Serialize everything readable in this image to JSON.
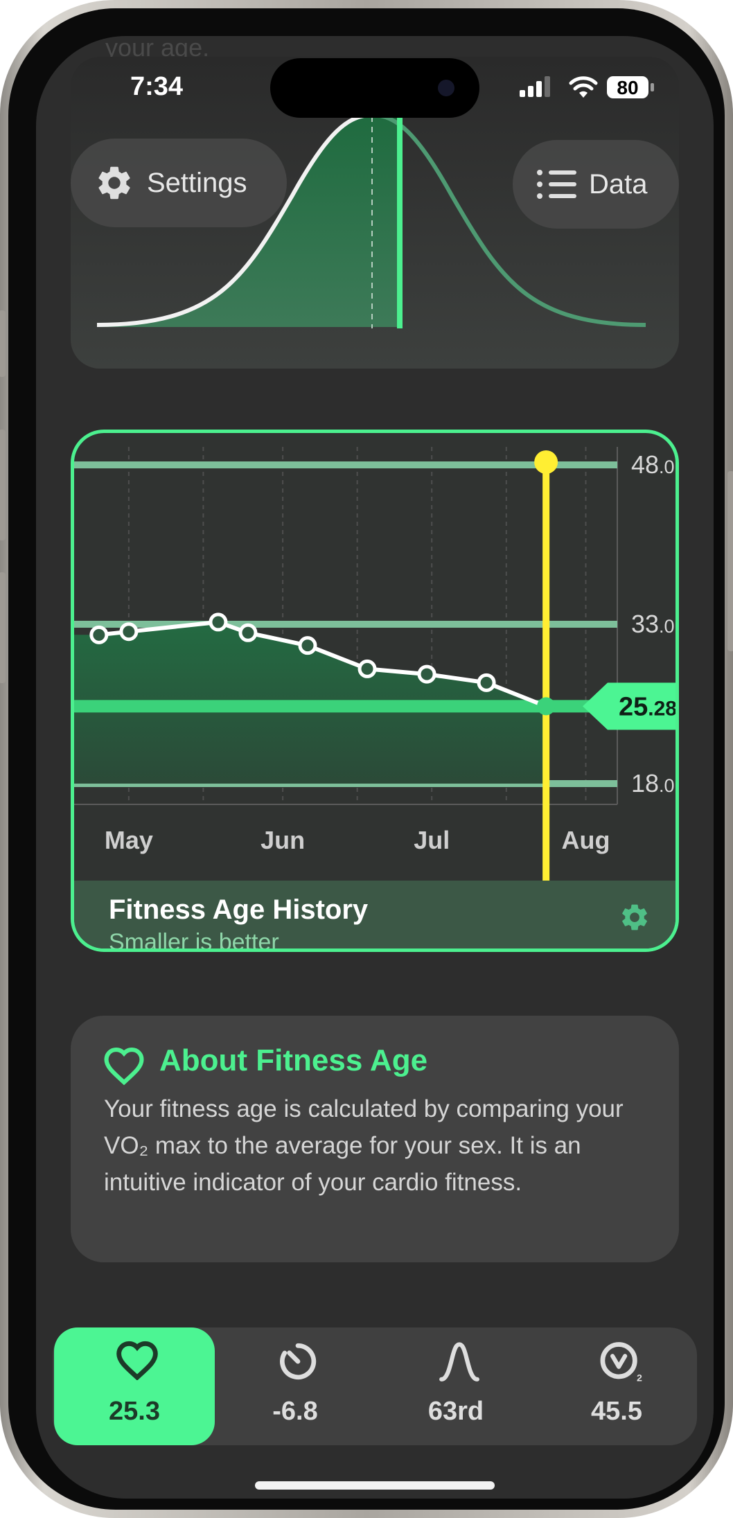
{
  "status": {
    "time": "7:34",
    "battery": "80"
  },
  "header": {
    "faded_text": "your age.",
    "settings_label": "Settings",
    "data_label": "Data"
  },
  "chart": {
    "title": "Fitness Age History",
    "subtitle": "Smaller is better",
    "current_whole": "25",
    "current_frac": ".28",
    "y_ticks": [
      {
        "main": "48",
        "frac": ".0"
      },
      {
        "main": "33",
        "frac": ".0"
      },
      {
        "main": "18",
        "frac": ".0"
      }
    ],
    "months": [
      "May",
      "Jun",
      "Jul",
      "Aug"
    ]
  },
  "chart_data": {
    "type": "area",
    "title": "Fitness Age History",
    "subtitle": "Smaller is better",
    "y_ticks": [
      48.0,
      33.0,
      18.0
    ],
    "ylim": [
      18.0,
      48.0
    ],
    "x_tick_labels": [
      "May",
      "Jun",
      "Jul",
      "Aug"
    ],
    "x": [
      "Apr 25",
      "May 1",
      "May 19",
      "May 25",
      "Jun 6",
      "Jun 18",
      "Jun 30",
      "Jul 12"
    ],
    "values": [
      32.0,
      32.3,
      33.2,
      32.2,
      31.0,
      28.8,
      28.3,
      27.5
    ],
    "current_value": 25.28,
    "grid": true,
    "colors": {
      "accent": "#4cf08f",
      "marker": "#ffee33"
    }
  },
  "about": {
    "title": "About Fitness Age",
    "body": "Your fitness age is calculated by comparing your VO₂ max to the average for your sex. It is an intuitive indicator of your cardio fitness."
  },
  "tabs": [
    {
      "label": "25.3",
      "icon": "heart-icon",
      "active": true
    },
    {
      "label": "-6.8",
      "icon": "stopwatch-icon",
      "active": false
    },
    {
      "label": "63rd",
      "icon": "bell-curve-icon",
      "active": false
    },
    {
      "label": "45.5",
      "icon": "vo2-icon",
      "active": false
    }
  ],
  "colors": {
    "accent": "#4cf08f",
    "yellow": "#ffee33",
    "background": "#2d2d2d"
  }
}
